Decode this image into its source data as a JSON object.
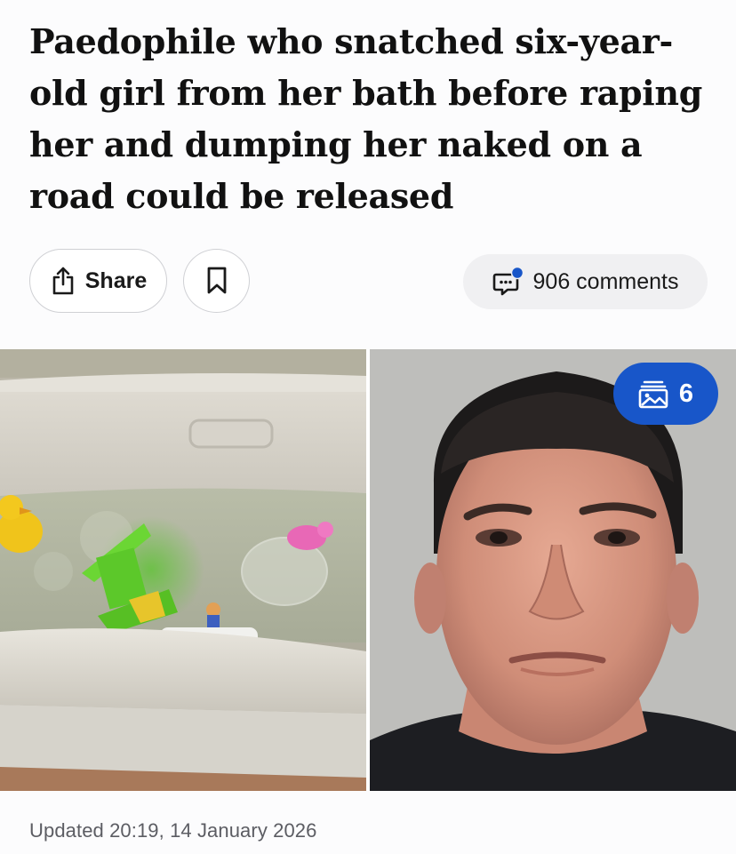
{
  "article": {
    "headline": "Paedophile who snatched six-year-old girl from her bath before raping her and dumping her naked on a road could be released",
    "updated": "Updated 20:19, 14 January 2026"
  },
  "actions": {
    "share_label": "Share",
    "bookmark_icon": "bookmark-icon",
    "share_icon": "share-icon",
    "comments_icon": "comment-bubble-icon",
    "comments_label": "906 comments",
    "notification_dot_color": "#1856c9"
  },
  "media": {
    "left_image": "bathtub with toys",
    "right_image": "police mugshot of a man",
    "gallery_icon": "image-gallery-icon",
    "gallery_count": "6",
    "gallery_badge_color": "#1856c9"
  }
}
